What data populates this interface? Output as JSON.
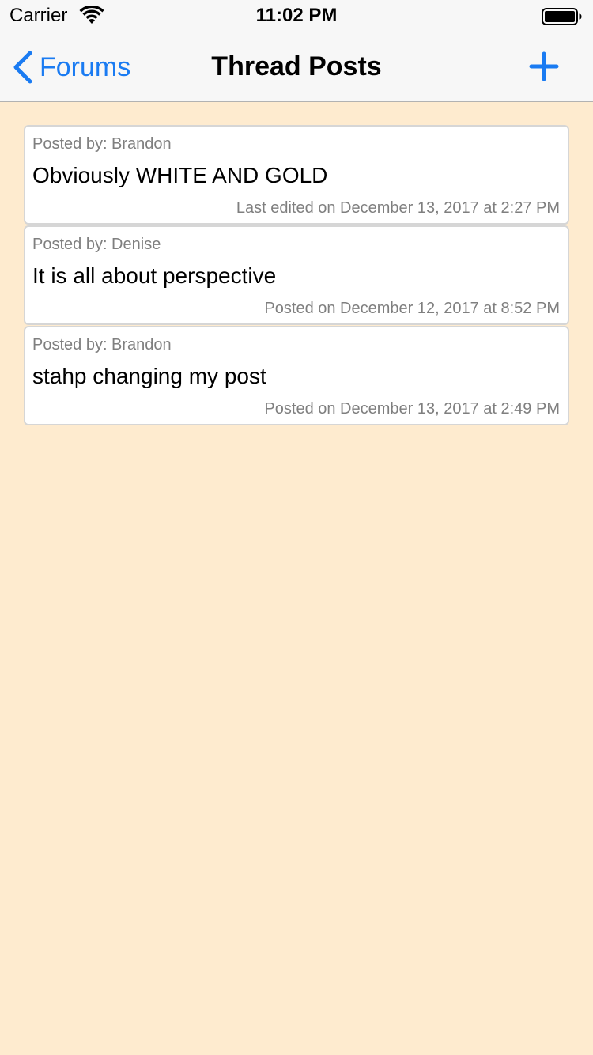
{
  "status_bar": {
    "carrier": "Carrier",
    "time": "11:02 PM",
    "wifi_icon": "wifi-icon",
    "battery_icon": "battery-icon"
  },
  "nav": {
    "back_label": "Forums",
    "back_icon": "chevron-left-icon",
    "title": "Thread Posts",
    "add_icon": "plus-icon",
    "accent_color": "#1a7bf2"
  },
  "background_color": "#feebcf",
  "posts": [
    {
      "author": "Posted by: Brandon",
      "body": "Obviously WHITE AND GOLD",
      "meta": "Last edited on December 13, 2017 at 2:27 PM"
    },
    {
      "author": "Posted by: Denise",
      "body": "It is all about perspective",
      "meta": "Posted on December 12, 2017 at 8:52 PM"
    },
    {
      "author": "Posted by: Brandon",
      "body": "stahp changing my post",
      "meta": "Posted on December 13, 2017 at 2:49 PM"
    }
  ]
}
